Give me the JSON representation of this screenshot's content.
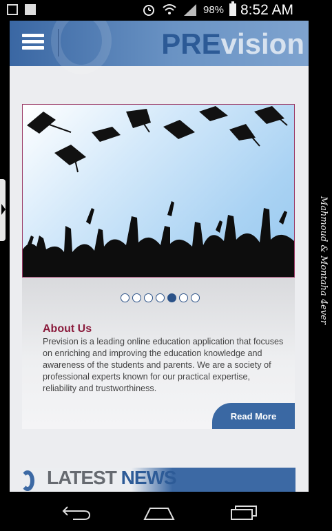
{
  "status_bar": {
    "battery_percent": "98%",
    "time": "8:52 AM",
    "icons": [
      "image-icon",
      "outlook-icon",
      "alarm-icon",
      "wifi-icon",
      "signal-icon",
      "battery-icon"
    ]
  },
  "header": {
    "brand_pre": "PRE",
    "brand_vision": "vision",
    "menu_icon": "menu-icon"
  },
  "slider": {
    "dot_count": 7,
    "active_dot": 5
  },
  "about": {
    "title": "About Us",
    "text": "Prevision is a leading online education application that focuses on enriching and improving the education knowledge and awareness of the students and parents. We are a society of professional experts known for our practical expertise, reliability and trustworthiness.",
    "read_more_label": "Read More"
  },
  "news": {
    "latest": "LATEST",
    "news": "NEWS"
  },
  "watermark": "Mahmoud & Montaha 4ever",
  "colors": {
    "brand_blue": "#2c5a96",
    "about_title": "#8a1a3b",
    "header_blue": "#3a67a3"
  }
}
